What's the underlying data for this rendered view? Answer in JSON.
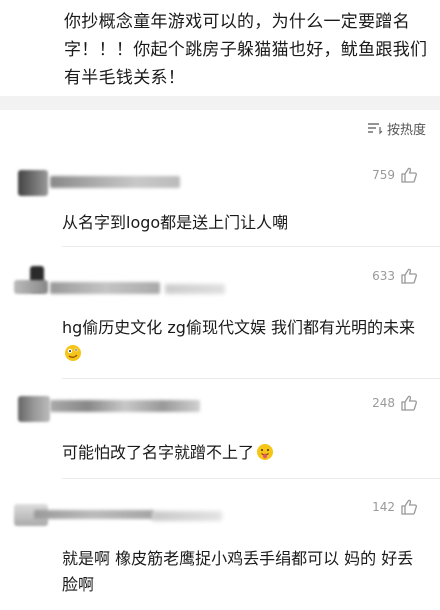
{
  "post": {
    "text": "你抄概念童年游戏可以的，为什么一定要蹭名字！！！你起个跳房子躲猫猫也好，鱿鱼跟我们有半毛钱关系！"
  },
  "sort": {
    "label": "按热度",
    "icon": "sort-lines-icon"
  },
  "comments": [
    {
      "likes": "759",
      "text": "从名字到logo都是送上门让人嘲",
      "emoji": ""
    },
    {
      "likes": "633",
      "text": "hg偷历史文化 zg偷现代文娱 我们都有光明的未来",
      "emoji": "crazy-face-emoji"
    },
    {
      "likes": "248",
      "text": "可能怕改了名字就蹭不上了",
      "emoji": "tongue-face-emoji"
    },
    {
      "likes": "142",
      "text": "就是啊 橡皮筋老鹰捉小鸡丢手绢都可以 妈的 好丢脸啊",
      "emoji": ""
    }
  ],
  "colors": {
    "text": "#1a1a1a",
    "muted": "#9a9a9a",
    "band": "#f2f2f2",
    "emoji": "#f5c518"
  }
}
